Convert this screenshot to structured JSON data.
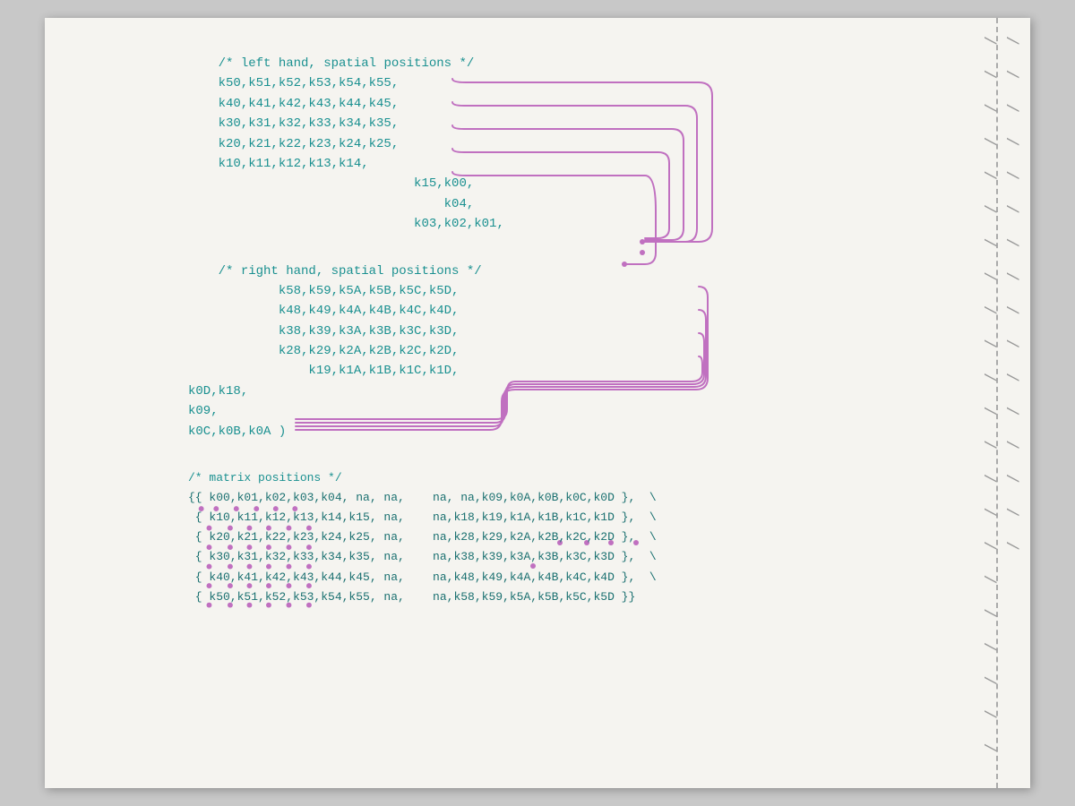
{
  "page": {
    "background": "#f5f4f0"
  },
  "left_hand": {
    "comment": "/* left hand, spatial positions */",
    "lines": [
      "k50,k51,k52,k53,k54,k55,",
      "k40,k41,k42,k43,k44,k45,",
      "k30,k31,k32,k33,k34,k35,",
      "k20,k21,k22,k23,k24,k25,",
      "k10,k11,k12,k13,k14,",
      "                    k15,k00,",
      "                        k04,",
      "                    k03,k02,k01,"
    ]
  },
  "right_hand": {
    "comment": "/* right hand, spatial positions */",
    "lines": [
      "        k58,k59,k5A,k5B,k5C,k5D,",
      "        k48,k49,k4A,k4B,k4C,k4D,",
      "        k38,k39,k3A,k3B,k3C,k3D,",
      "        k28,k29,k2A,k2B,k2C,k2D,",
      "            k19,k1A,k1B,k1C,k1D,",
      "k0D,k18,",
      "k09,",
      "k0C,k0B,k0A )"
    ]
  },
  "matrix": {
    "comment": "/* matrix positions */",
    "lines": [
      "{{ k00,k01,k02,k03,k04, na, na,    na, na,k09,k0A,k0B,k0C,k0D },",
      " { k10,k11,k12,k13,k14,k15, na,    na,k18,k19,k1A,k1B,k1C,k1D },",
      " { k20,k21,k22,k23,k24,k25, na,    na,k28,k29,k2A,k2B,k2C,k2D },",
      " { k30,k31,k32,k33,k34,k35, na,    na,k38,k39,k3A,k3B,k3C,k3D },",
      " { k40,k41,k42,k43,k44,k45, na,    na,k48,k49,k4A,k4B,k4C,k4D },",
      " { k50,k51,k52,k53,k54,k55, na,    na,k58,k59,k5A,k5B,k5C,k5D }}"
    ]
  },
  "backslashes": [
    "\\",
    "\\",
    "\\",
    "\\",
    "\\",
    "\\",
    "\\",
    "\\",
    "\\",
    "\\",
    "\\",
    "\\",
    "\\",
    "\\",
    "\\",
    "\\",
    "\\",
    "\\",
    "\\",
    "\\",
    "\\",
    "\\",
    "\\",
    "\\",
    "\\",
    "\\",
    "\\",
    "\\",
    "\\",
    "\\",
    "\\",
    "\\",
    "\\",
    "\\",
    "\\",
    "\\",
    "\\",
    "\\",
    "\\"
  ]
}
